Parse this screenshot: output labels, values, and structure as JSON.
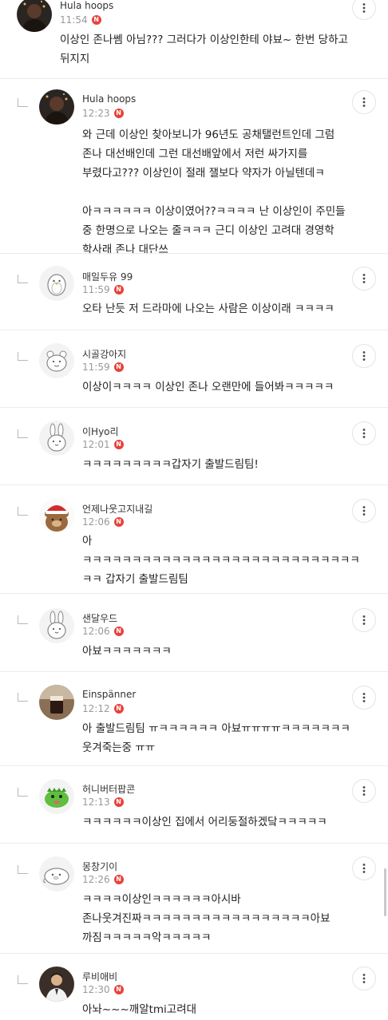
{
  "comments": [
    {
      "nick": "Hula hoops",
      "time": "11:54",
      "body": "이상인 존나쎔 아님??? 그러다가 이상인한테 야뵤~ 한번 당하고\n뒤지지",
      "avatar": "photo-dark-woman",
      "reply": false
    },
    {
      "nick": "Hula hoops",
      "time": "12:23",
      "body": "와 근데 이상인 찾아보니가 96년도 공채탤런트인데 그럼\n존나 대선배인데 그런 대선배앞에서 저런 싸가지를\n부렸다고??? 이상인이 절래 잴보다 약자가 아닐텐데ㅋ\n\n아ㅋㅋㅋㅋㅋㅋ 이상이였어??ㅋㅋㅋㅋ 난 이상인이 주민들\n중 한명으로 나오는 줄ㅋㅋㅋ 근디 이상인 고려대 경영학\n학사래 존나 대단쓰",
      "avatar": "photo-dark-woman",
      "reply": true
    },
    {
      "nick": "매일두유 99",
      "time": "11:59",
      "body": "오타 난듯 저 드라마에 나오는 사람은 이상이래 ㅋㅋㅋㅋ",
      "avatar": "penguin-sketch",
      "reply": true
    },
    {
      "nick": "시골강아지",
      "time": "11:59",
      "body": "이상이ㅋㅋㅋㅋ 이상인 존나 오랜만에 들어봐ㅋㅋㅋㅋㅋ",
      "avatar": "bear-sketch",
      "reply": true
    },
    {
      "nick": "이Hyo리",
      "time": "12:01",
      "body": "ㅋㅋㅋㅋㅋㅋㅋㅋㅋ갑자기 출발드림팀!",
      "avatar": "rabbit-sketch",
      "reply": true
    },
    {
      "nick": "언제나웃고지내길",
      "time": "12:06",
      "body": "아\nㅋㅋㅋㅋㅋㅋㅋㅋㅋㅋㅋㅋㅋㅋㅋㅋㅋㅋㅋㅋㅋㅋㅋㅋㅋㅋㅋㅋ\nㅋㅋ 갑자기 출발드림팀",
      "avatar": "teddy-bear-santa-hat",
      "reply": true
    },
    {
      "nick": "샌달우드",
      "time": "12:06",
      "body": "아뵤ㅋㅋㅋㅋㅋㅋㅋ",
      "avatar": "rabbit-sketch",
      "reply": true
    },
    {
      "nick": "Einspänner",
      "time": "12:12",
      "body": "아 출발드림팀 ㅠㅋㅋㅋㅋㅋㅋ 아뵤ㅠㅠㅠㅠㅋㅋㅋㅋㅋㅋㅋ\n웃겨죽는중 ㅠㅠ",
      "avatar": "coffee-glass-photo",
      "reply": true
    },
    {
      "nick": "허니버터팝콘",
      "time": "12:13",
      "body": "ㅋㅋㅋㅋㅋㅋ이상인 집에서 어리둥절하겠닼ㅋㅋㅋㅋㅋ",
      "avatar": "green-dinosaur",
      "reply": true
    },
    {
      "nick": "몽창기이",
      "time": "12:26",
      "body": "ㅋㅋㅋㅋ이상인ㅋㅋㅋㅋㅋㅋ아시바\n존나웃겨진짜ㅋㅋㅋㅋㅋㅋㅋㅋㅋㅋㅋㅋㅋㅋㅋㅋㅋ아뵤\n까짐ㅋㅋㅋㅋㅋ악ㅋㅋㅋㅋㅋ",
      "avatar": "seal-sketch",
      "reply": true
    },
    {
      "nick": "루비애비",
      "time": "12:30",
      "body": "아놔~~~깨알tmi고려대",
      "avatar": "photo-man-suit",
      "reply": true
    }
  ],
  "icons": {
    "more": "more-vertical-icon",
    "badge": "N"
  },
  "colors": {
    "badge": "#e8413a",
    "divider": "#ececec",
    "meta": "#999999"
  }
}
